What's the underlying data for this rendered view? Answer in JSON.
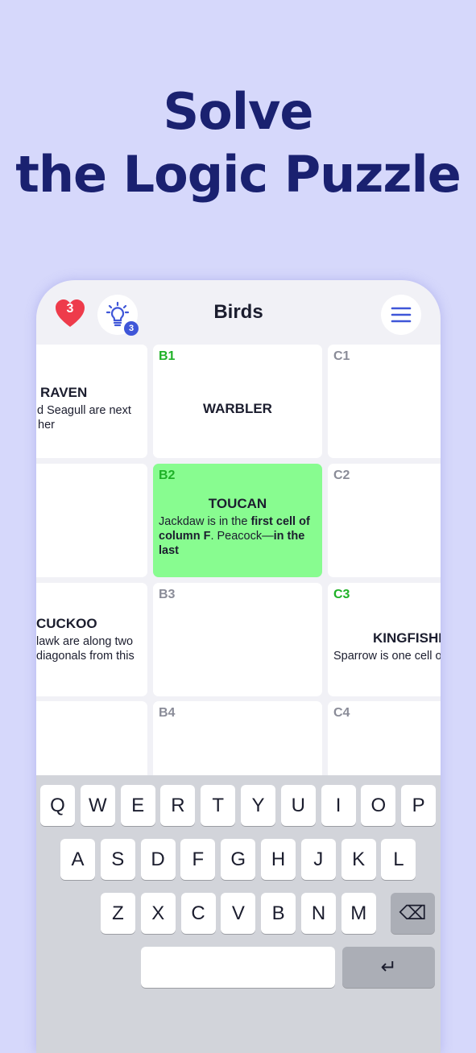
{
  "headline": {
    "line1": "Solve",
    "line2": "the Logic Puzzle"
  },
  "topbar": {
    "lives": "3",
    "hints": "3",
    "title": "Birds",
    "icons": {
      "lives": "heart-icon",
      "hint": "lightbulb-icon",
      "menu": "hamburger-menu-icon"
    }
  },
  "colors": {
    "accent": "#3f56d8",
    "correct_label": "#1fb127",
    "selected_cell": "#88fc90",
    "heart": "#ee3b4b",
    "headline": "#1a2170"
  },
  "grid": {
    "a1": {
      "word": "RAVEN",
      "clue_lines": [
        "d Seagull are next",
        "her"
      ]
    },
    "a3": {
      "word": "CUCKOO",
      "clue_lines": [
        "lawk are along two",
        "diagonals from this"
      ]
    },
    "b1": {
      "label": "B1",
      "word": "WARBLER"
    },
    "b2": {
      "label": "B2",
      "word": "TOUCAN",
      "clue": {
        "p1": "Jackdaw is in the ",
        "b1": "first cell of column F",
        "p2": ". Peacock—",
        "b2": "in the last"
      }
    },
    "b3": {
      "label": "B3"
    },
    "b4": {
      "label": "B4"
    },
    "c1": {
      "label": "C1"
    },
    "c2": {
      "label": "C2"
    },
    "c3": {
      "label": "C3",
      "word": "KINGFISHE",
      "clue": "Sparrow is one cell o"
    },
    "c4": {
      "label": "C4"
    }
  },
  "keyboard": {
    "row1": [
      "Q",
      "W",
      "E",
      "R",
      "T",
      "Y",
      "U",
      "I",
      "O",
      "P"
    ],
    "row2": [
      "A",
      "S",
      "D",
      "F",
      "G",
      "H",
      "J",
      "K",
      "L"
    ],
    "row3": [
      "Z",
      "X",
      "C",
      "V",
      "B",
      "N",
      "M"
    ],
    "backspace": "⌫",
    "enter": "↵"
  }
}
